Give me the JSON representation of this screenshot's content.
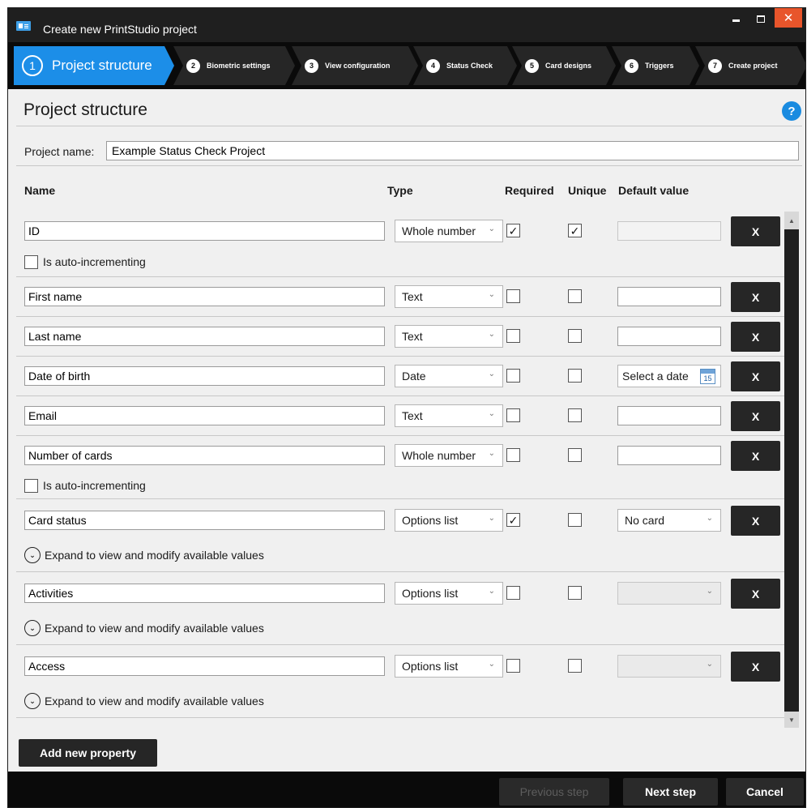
{
  "window": {
    "title": "Create new PrintStudio project",
    "colors": {
      "titlebar": "#1f1f1f",
      "close": "#e8552b",
      "accent": "#1c8ee8",
      "button": "#262626"
    }
  },
  "steps": [
    {
      "num": "1",
      "label": "Project structure",
      "active": true
    },
    {
      "num": "2",
      "label": "Biometric settings"
    },
    {
      "num": "3",
      "label": "View configuration"
    },
    {
      "num": "4",
      "label": "Status Check"
    },
    {
      "num": "5",
      "label": "Card designs"
    },
    {
      "num": "6",
      "label": "Triggers"
    },
    {
      "num": "7",
      "label": "Create project"
    }
  ],
  "page": {
    "title": "Project structure",
    "help": "?"
  },
  "project": {
    "name_label": "Project name:",
    "name_value": "Example Status Check Project"
  },
  "columns": {
    "name": "Name",
    "type": "Type",
    "required": "Required",
    "unique": "Unique",
    "default": "Default value"
  },
  "properties": [
    {
      "name": "ID",
      "type": "Whole number",
      "required": "✓",
      "unique": "✓",
      "auto_label": "Is auto-incrementing"
    },
    {
      "name": "First name",
      "type": "Text",
      "required": "",
      "unique": ""
    },
    {
      "name": "Last name",
      "type": "Text",
      "required": "",
      "unique": ""
    },
    {
      "name": "Date of birth",
      "type": "Date",
      "required": "",
      "unique": "",
      "default": "Select a date",
      "cal_day": "15"
    },
    {
      "name": "Email",
      "type": "Text",
      "required": "",
      "unique": ""
    },
    {
      "name": "Number of cards",
      "type": "Whole number",
      "required": "",
      "unique": "",
      "auto_label": "Is auto-incrementing"
    },
    {
      "name": "Card status",
      "type": "Options list",
      "required": "✓",
      "unique": "",
      "default": "No card",
      "expand_label": "Expand to view and modify available values"
    },
    {
      "name": "Activities",
      "type": "Options list",
      "required": "",
      "unique": "",
      "default": "",
      "expand_label": "Expand to view and modify available values"
    },
    {
      "name": "Access",
      "type": "Options list",
      "required": "",
      "unique": "",
      "default": "",
      "expand_label": "Expand to view and modify available values"
    }
  ],
  "delete_label": "X",
  "add_property": "Add new property",
  "footer": {
    "previous": "Previous step",
    "next": "Next step",
    "cancel": "Cancel"
  }
}
